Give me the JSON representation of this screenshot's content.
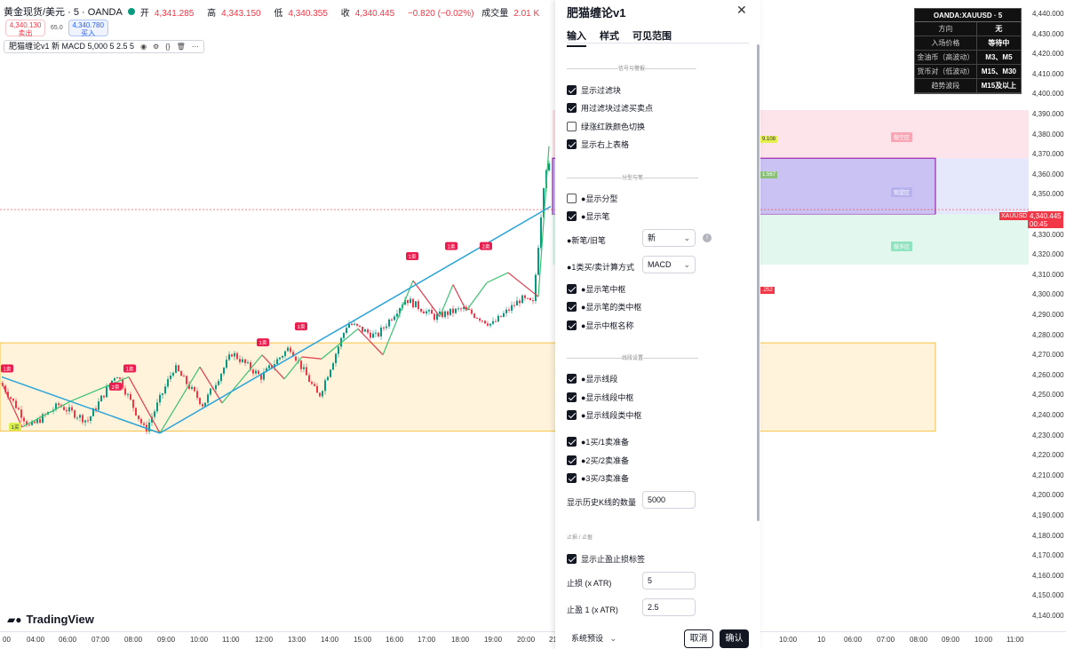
{
  "header": {
    "symbol": "黄金现货/美元 · 5 · OANDA",
    "ohlc": [
      {
        "label": "开",
        "value": "4,341.285"
      },
      {
        "label": "高",
        "value": "4,343.150"
      },
      {
        "label": "低",
        "value": "4,340.355"
      },
      {
        "label": "收",
        "value": "4,340.445"
      }
    ],
    "change": "−0.820 (−0.02%)",
    "volume_label": "成交量",
    "volume": "2.01 K"
  },
  "trade": {
    "sell_price": "4,340.130",
    "sell_label": "卖出",
    "spread": "65.0",
    "buy_price": "4,340.780",
    "buy_label": "买入"
  },
  "indicator": {
    "label": "肥猫缠论v1 新 MACD 5,000 5 2.5 5"
  },
  "logo": "TradingView",
  "info_table": {
    "title": "OANDA:XAUUSD · 5",
    "rows": [
      {
        "k": "方向",
        "v": "无"
      },
      {
        "k": "入场价格",
        "v": "等待中"
      },
      {
        "k": "金油币（高波动）",
        "v": "M3、M5"
      },
      {
        "k": "货币对（低波动）",
        "v": "M15、M30"
      },
      {
        "k": "趋势波段",
        "v": "M15及以上"
      }
    ]
  },
  "y_axis": [
    "4,440.000",
    "4,430.000",
    "4,420.000",
    "4,410.000",
    "4,400.000",
    "4,390.000",
    "4,380.000",
    "4,370.000",
    "4,360.000",
    "4,350.000",
    "4,340.000",
    "4,330.000",
    "4,320.000",
    "4,310.000",
    "4,300.000",
    "4,290.000",
    "4,280.000",
    "4,270.000",
    "4,260.000",
    "4,250.000",
    "4,240.000",
    "4,230.000",
    "4,220.000",
    "4,210.000",
    "4,200.000",
    "4,190.000",
    "4,180.000",
    "4,170.000",
    "4,160.000",
    "4,150.000",
    "4,140.000"
  ],
  "x_axis": [
    "00",
    "04:00",
    "06:00",
    "07:00",
    "08:00",
    "09:00",
    "10:00",
    "11:00",
    "12:00",
    "13:00",
    "14:00",
    "15:00",
    "16:00",
    "17:00",
    "18:00",
    "19:00",
    "20:00",
    "21",
    "10:00",
    "10",
    "06:00",
    "07:00",
    "08:00",
    "09:00",
    "10:00",
    "11:00"
  ],
  "last_price": {
    "symbol": "XAUUSD",
    "price": "4,340.445",
    "countdown": "00:45"
  },
  "zones": {
    "sell": "做空区",
    "watch": "观望区",
    "buy": "做多区",
    "tag_a": "9.108",
    "tag_b": "1.567",
    "tag_c": ".252"
  },
  "chart_labels": {
    "buy1": "1买",
    "sell1": "1卖",
    "sell2": "2卖",
    "buy2": "2买"
  },
  "dialog": {
    "title": "肥猫缠论v1",
    "tabs": [
      "输入",
      "样式",
      "可见范围"
    ],
    "sec_signal": "-----------------------------信号与警报-----------------------------",
    "sec_fractal": "-------------------------------分型与笔-------------------------------",
    "sec_segment": "-------------------------------线段设置-------------------------------",
    "sec_stop": "止损 / 止盈",
    "checks": {
      "show_filter": "显示过滤块",
      "filter_bs": "用过滤块过滤买卖点",
      "color_switch": "绿涨红跌颜色切换",
      "show_table": "显示右上表格",
      "show_fractal": "●显示分型",
      "show_bi": "●显示笔",
      "show_bi_center": "●显示笔中枢",
      "show_bi_class_center": "●显示笔的类中枢",
      "show_center_name": "●显示中枢名称",
      "show_segment": "●显示线段",
      "show_seg_center": "●显示线段中枢",
      "show_seg_class_center": "●显示线段类中枢",
      "bs1": "●1买/1卖准备",
      "bs2": "●2买/2卖准备",
      "bs3": "●3买/3卖准备",
      "show_tp_sl": "显示止盈止损标签"
    },
    "new_old_label": "●新笔/旧笔",
    "new_old_value": "新",
    "calc_label": "●1类买/卖计算方式",
    "calc_value": "MACD",
    "history_label": "显示历史K线的数量",
    "history_value": "5000",
    "sl_label": "止损 (x ATR)",
    "sl_value": "5",
    "tp_label": "止盈 1 (x ATR)",
    "tp_value": "2.5",
    "preset": "系统预设",
    "cancel": "取消",
    "confirm": "确认"
  },
  "chart_data": {
    "type": "candlestick",
    "ylim": [
      4136,
      4446
    ],
    "segments": [
      [
        0,
        4254
      ],
      [
        1,
        4232
      ],
      [
        2,
        4243
      ],
      [
        3,
        4235
      ],
      [
        4,
        4259
      ],
      [
        5,
        4230
      ],
      [
        6,
        4262
      ],
      [
        7,
        4243
      ],
      [
        8,
        4269
      ],
      [
        9,
        4257
      ],
      [
        10,
        4272
      ],
      [
        11,
        4247
      ],
      [
        12,
        4284
      ],
      [
        13,
        4277
      ],
      [
        14,
        4296
      ],
      [
        15,
        4287
      ],
      [
        16,
        4291
      ],
      [
        17,
        4283
      ],
      [
        18,
        4296
      ],
      [
        19,
        4290
      ]
    ]
  },
  "colors": {
    "up": "#089981",
    "down": "#f23645",
    "accent": "#2962ff"
  }
}
